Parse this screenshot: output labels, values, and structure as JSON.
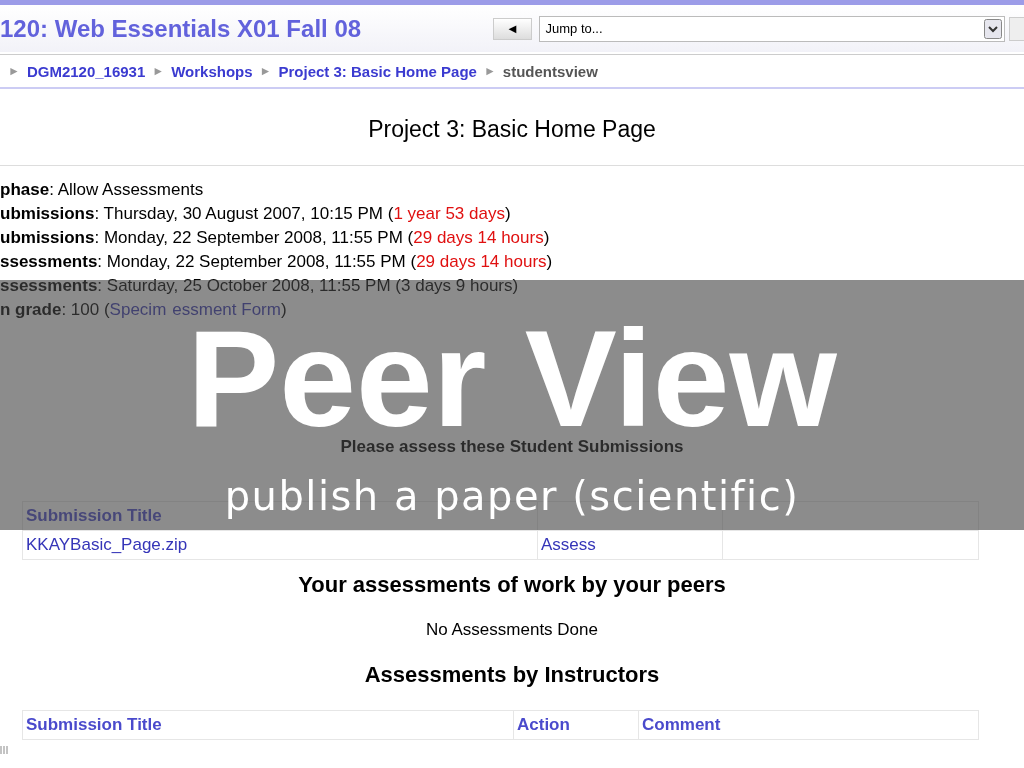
{
  "header": {
    "course_title": "120: Web Essentials X01 Fall 08",
    "back_button": "◄",
    "jump_menu": {
      "value": "Jump to..."
    }
  },
  "breadcrumb": {
    "separator": "►",
    "items": [
      {
        "label": "DGM2120_16931",
        "link": true
      },
      {
        "label": "Workshops",
        "link": true
      },
      {
        "label": "Project 3: Basic Home Page",
        "link": true
      },
      {
        "label": "studentsview",
        "link": false
      }
    ]
  },
  "page_title": "Project 3: Basic Home Page",
  "details": [
    {
      "segments": [
        {
          "kind": "label",
          "text": "phase"
        },
        {
          "kind": "plain",
          "text": ": Allow Assessments"
        }
      ]
    },
    {
      "segments": [
        {
          "kind": "label",
          "text": "ubmissions"
        },
        {
          "kind": "plain",
          "text": ": Thursday, 30 August 2007, 10:15 PM ("
        },
        {
          "kind": "alert",
          "text": "1 year 53 days"
        },
        {
          "kind": "plain",
          "text": ")"
        }
      ]
    },
    {
      "segments": [
        {
          "kind": "label",
          "text": "ubmissions"
        },
        {
          "kind": "plain",
          "text": ": Monday, 22 September 2008, 11:55 PM ("
        },
        {
          "kind": "alert",
          "text": "29 days 14 hours"
        },
        {
          "kind": "plain",
          "text": ")"
        }
      ]
    },
    {
      "segments": [
        {
          "kind": "label",
          "text": "ssessments"
        },
        {
          "kind": "plain",
          "text": ": Monday, 22 September 2008, 11:55 PM ("
        },
        {
          "kind": "alert",
          "text": "29 days 14 hours"
        },
        {
          "kind": "plain",
          "text": ")"
        }
      ]
    },
    {
      "segments": [
        {
          "kind": "label",
          "text": "ssessments"
        },
        {
          "kind": "plain",
          "text": ": Saturday, 25 October 2008, 11:55 PM (3 days 9 hours)"
        }
      ]
    },
    {
      "segments": [
        {
          "kind": "label",
          "text": "n grade"
        },
        {
          "kind": "plain",
          "text": ": 100 ("
        },
        {
          "kind": "link",
          "text": "Specim"
        },
        {
          "kind": "link",
          "text": "essment Form"
        },
        {
          "kind": "plain",
          "text": ")"
        }
      ]
    }
  ],
  "submissions_heading": "Please assess these Student Submissions",
  "submissions_table": {
    "columns": [
      "Submission Title"
    ],
    "rows": [
      [
        "KKAYBasic_Page.zip",
        "Assess"
      ]
    ]
  },
  "peer_heading": "Your assessments of work by your peers",
  "peer_empty": "No Assessments Done",
  "instructor_heading": "Assessments by Instructors",
  "instructor_table": {
    "columns": [
      "Submission Title",
      "Action",
      "Comment"
    ]
  },
  "overlay": {
    "title": "Peer View",
    "subtitle": "publish a paper (scientific)"
  }
}
